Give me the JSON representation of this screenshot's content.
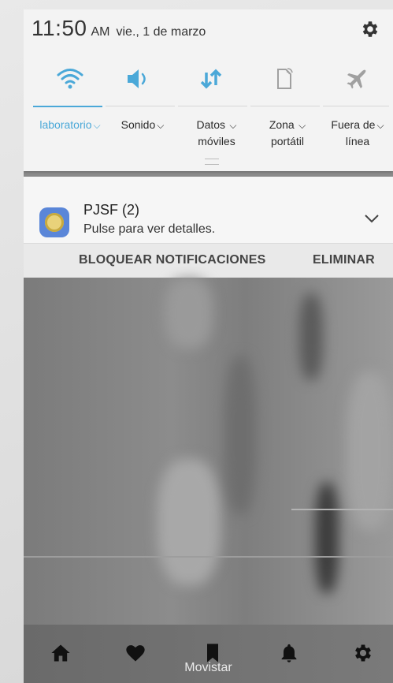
{
  "status": {
    "time": "11:50",
    "ampm": "AM",
    "date": "vie., 1 de marzo"
  },
  "quick_tiles": [
    {
      "label": "laboratorio",
      "icon": "wifi-icon",
      "active": true
    },
    {
      "label": "Sonido",
      "icon": "volume-icon",
      "active": true
    },
    {
      "label": "Datos móviles",
      "line1": "Datos",
      "line2": "móviles",
      "icon": "mobile-data-icon",
      "active": true
    },
    {
      "label": "Zona portátil",
      "line1": "Zona",
      "line2": "portátil",
      "icon": "hotspot-icon",
      "active": false
    },
    {
      "label": "Fuera de línea",
      "line1": "Fuera de",
      "line2": "línea",
      "icon": "airplane-icon",
      "active": false
    }
  ],
  "notification": {
    "title": "PJSF (2)",
    "text": "Pulse para ver detalles.",
    "actions": {
      "block": "BLOQUEAR NOTIFICACIONES",
      "delete": "ELIMINAR"
    }
  },
  "bottom_nav": {
    "carrier": "Movistar",
    "items": [
      "home-icon",
      "heart-icon",
      "bookmark-icon",
      "bell-icon",
      "settings-icon"
    ]
  },
  "colors": {
    "accent": "#4aa8d8",
    "inactive_icon": "#9a9a9a"
  }
}
